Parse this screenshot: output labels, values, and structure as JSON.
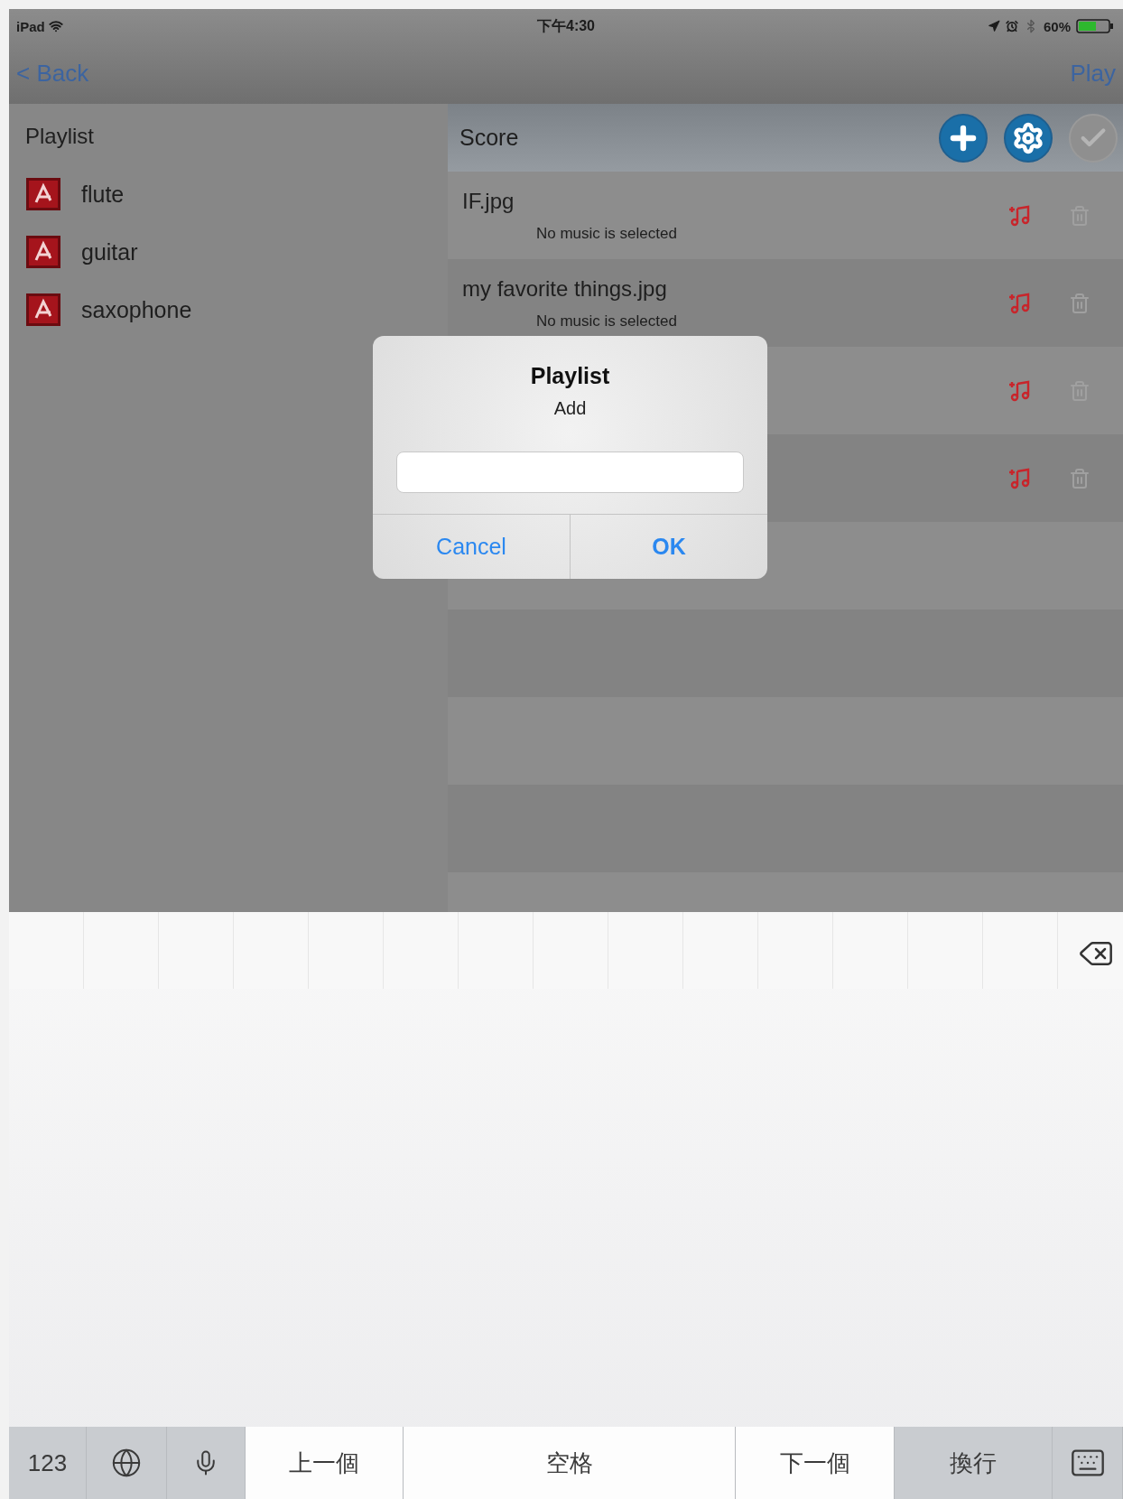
{
  "status_bar": {
    "device": "iPad",
    "time": "下午4:30",
    "battery": "60%"
  },
  "nav_bar": {
    "back": "< Back",
    "action": "Play"
  },
  "playlist": {
    "title": "Playlist",
    "items": [
      {
        "name": "flute"
      },
      {
        "name": "guitar"
      },
      {
        "name": "saxophone"
      }
    ]
  },
  "score": {
    "title": "Score",
    "tools": [
      {
        "kind": "add",
        "disabled": false
      },
      {
        "kind": "settings",
        "disabled": false
      },
      {
        "kind": "done",
        "disabled": true
      }
    ],
    "rows": [
      {
        "kind": "file",
        "name": "IF.jpg",
        "subtitle": "No music is selected"
      },
      {
        "kind": "file",
        "name": "my favorite things.jpg",
        "subtitle": "No music is selected"
      },
      {
        "kind": "file"
      },
      {
        "kind": "file"
      }
    ]
  },
  "dialog": {
    "title": "Playlist",
    "message": "Add",
    "buttons": [
      {
        "label": "Cancel",
        "bold": false
      },
      {
        "label": "OK",
        "bold": true
      }
    ]
  },
  "keyboard": {
    "keys": [
      {
        "kind": "text",
        "label": "123",
        "function_key": true
      },
      {
        "kind": "globe",
        "function_key": true
      },
      {
        "kind": "mic",
        "function_key": true
      },
      {
        "kind": "text",
        "label": "上一個",
        "function_key": false
      },
      {
        "kind": "text",
        "label": "空格",
        "function_key": false
      },
      {
        "kind": "text",
        "label": "下一個",
        "function_key": false
      },
      {
        "kind": "text",
        "label": "換行",
        "function_key": true
      },
      {
        "kind": "hide",
        "function_key": true
      }
    ]
  }
}
